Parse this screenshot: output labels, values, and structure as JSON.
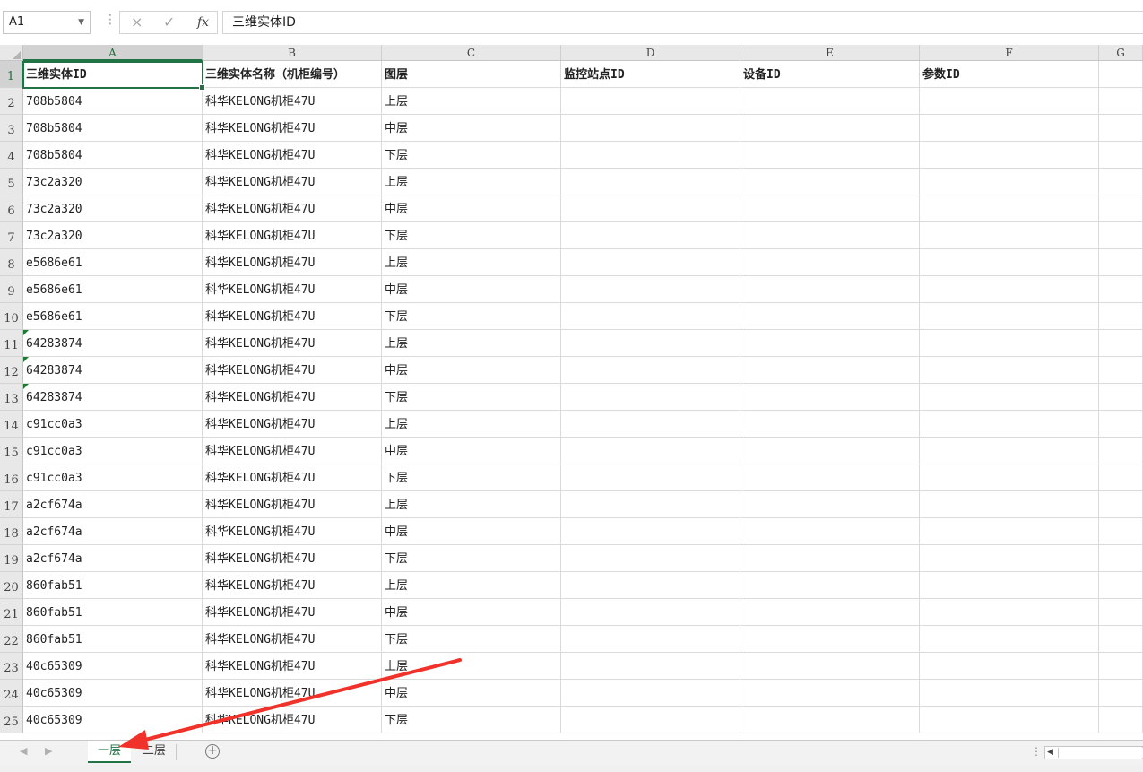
{
  "formula_bar": {
    "name_box": "A1",
    "cancel_icon": "×",
    "enter_icon": "✓",
    "fx_label": "fx",
    "content": "三维实体ID"
  },
  "columns": [
    "A",
    "B",
    "C",
    "D",
    "E",
    "F",
    "G"
  ],
  "header_row": [
    "三维实体ID",
    "三维实体名称（机柜编号）",
    "图层",
    "监控站点ID",
    "设备ID",
    "参数ID",
    ""
  ],
  "rows": [
    {
      "num": "1"
    },
    {
      "num": "2",
      "a": "708b5804",
      "b": "科华KELONG机柜47U",
      "c": "上层",
      "flag": false
    },
    {
      "num": "3",
      "a": "708b5804",
      "b": "科华KELONG机柜47U",
      "c": "中层",
      "flag": false
    },
    {
      "num": "4",
      "a": "708b5804",
      "b": "科华KELONG机柜47U",
      "c": "下层",
      "flag": false
    },
    {
      "num": "5",
      "a": "73c2a320",
      "b": "科华KELONG机柜47U",
      "c": "上层",
      "flag": false
    },
    {
      "num": "6",
      "a": "73c2a320",
      "b": "科华KELONG机柜47U",
      "c": "中层",
      "flag": false
    },
    {
      "num": "7",
      "a": "73c2a320",
      "b": "科华KELONG机柜47U",
      "c": "下层",
      "flag": false
    },
    {
      "num": "8",
      "a": "e5686e61",
      "b": "科华KELONG机柜47U",
      "c": "上层",
      "flag": false
    },
    {
      "num": "9",
      "a": "e5686e61",
      "b": "科华KELONG机柜47U",
      "c": "中层",
      "flag": false
    },
    {
      "num": "10",
      "a": "e5686e61",
      "b": "科华KELONG机柜47U",
      "c": "下层",
      "flag": false
    },
    {
      "num": "11",
      "a": "64283874",
      "b": "科华KELONG机柜47U",
      "c": "上层",
      "flag": true
    },
    {
      "num": "12",
      "a": "64283874",
      "b": "科华KELONG机柜47U",
      "c": "中层",
      "flag": true
    },
    {
      "num": "13",
      "a": "64283874",
      "b": "科华KELONG机柜47U",
      "c": "下层",
      "flag": true
    },
    {
      "num": "14",
      "a": "c91cc0a3",
      "b": "科华KELONG机柜47U",
      "c": "上层",
      "flag": false
    },
    {
      "num": "15",
      "a": "c91cc0a3",
      "b": "科华KELONG机柜47U",
      "c": "中层",
      "flag": false
    },
    {
      "num": "16",
      "a": "c91cc0a3",
      "b": "科华KELONG机柜47U",
      "c": "下层",
      "flag": false
    },
    {
      "num": "17",
      "a": "a2cf674a",
      "b": "科华KELONG机柜47U",
      "c": "上层",
      "flag": false
    },
    {
      "num": "18",
      "a": "a2cf674a",
      "b": "科华KELONG机柜47U",
      "c": "中层",
      "flag": false
    },
    {
      "num": "19",
      "a": "a2cf674a",
      "b": "科华KELONG机柜47U",
      "c": "下层",
      "flag": false
    },
    {
      "num": "20",
      "a": "860fab51",
      "b": "科华KELONG机柜47U",
      "c": "上层",
      "flag": false
    },
    {
      "num": "21",
      "a": "860fab51",
      "b": "科华KELONG机柜47U",
      "c": "中层",
      "flag": false
    },
    {
      "num": "22",
      "a": "860fab51",
      "b": "科华KELONG机柜47U",
      "c": "下层",
      "flag": false
    },
    {
      "num": "23",
      "a": "40c65309",
      "b": "科华KELONG机柜47U",
      "c": "上层",
      "flag": false
    },
    {
      "num": "24",
      "a": "40c65309",
      "b": "科华KELONG机柜47U",
      "c": "中层",
      "flag": false
    },
    {
      "num": "25",
      "a": "40c65309",
      "b": "科华KELONG机柜47U",
      "c": "下层",
      "flag": false
    }
  ],
  "sheet_tabs": {
    "tabs": [
      "一层",
      "二层"
    ],
    "active": 0,
    "add_icon": "+"
  },
  "colors": {
    "accent": "#217346",
    "annotation_arrow": "#f0322a"
  }
}
